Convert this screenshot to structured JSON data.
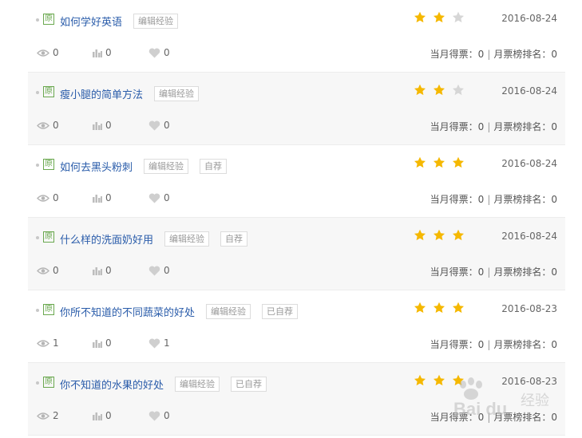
{
  "items": [
    {
      "title": "如何学好英语",
      "tags": [
        "编辑经验"
      ],
      "stars": 2,
      "date": "2016-08-24",
      "views": "0",
      "votes_stat": "0",
      "likes": "0",
      "month_votes_label": "当月得票：0",
      "rank_label": "月票榜排名：0"
    },
    {
      "title": "瘦小腿的简单方法",
      "tags": [
        "编辑经验"
      ],
      "stars": 2,
      "date": "2016-08-24",
      "views": "0",
      "votes_stat": "0",
      "likes": "0",
      "month_votes_label": "当月得票：0",
      "rank_label": "月票榜排名：0"
    },
    {
      "title": "如何去黑头粉刺",
      "tags": [
        "编辑经验",
        "自荐"
      ],
      "stars": 3,
      "date": "2016-08-24",
      "views": "0",
      "votes_stat": "0",
      "likes": "0",
      "month_votes_label": "当月得票：0",
      "rank_label": "月票榜排名：0"
    },
    {
      "title": "什么样的洗面奶好用",
      "tags": [
        "编辑经验",
        "自荐"
      ],
      "stars": 3,
      "date": "2016-08-24",
      "views": "0",
      "votes_stat": "0",
      "likes": "0",
      "month_votes_label": "当月得票：0",
      "rank_label": "月票榜排名：0"
    },
    {
      "title": "你所不知道的不同蔬菜的好处",
      "tags": [
        "编辑经验",
        "已自荐"
      ],
      "stars": 3,
      "date": "2016-08-23",
      "views": "1",
      "votes_stat": "0",
      "likes": "1",
      "month_votes_label": "当月得票：0",
      "rank_label": "月票榜排名：0"
    },
    {
      "title": "你不知道的水果的好处",
      "tags": [
        "编辑经验",
        "已自荐"
      ],
      "stars": 3,
      "date": "2016-08-23",
      "views": "2",
      "votes_stat": "0",
      "likes": "0",
      "month_votes_label": "当月得票：0",
      "rank_label": "月票榜排名：0"
    }
  ],
  "labels": {
    "original_badge": "原",
    "separator": "|",
    "max_stars": 3
  },
  "watermark": {
    "brand": "Bai du",
    "suffix": "经验"
  },
  "colors": {
    "star_on": "#f5b800",
    "star_off": "#d6d6d6",
    "title": "#2a5caa",
    "badge": "#6aa84f"
  },
  "icons": {
    "views": "eye-icon",
    "votes": "bar-chart-icon",
    "likes": "heart-icon",
    "star": "star-icon"
  }
}
